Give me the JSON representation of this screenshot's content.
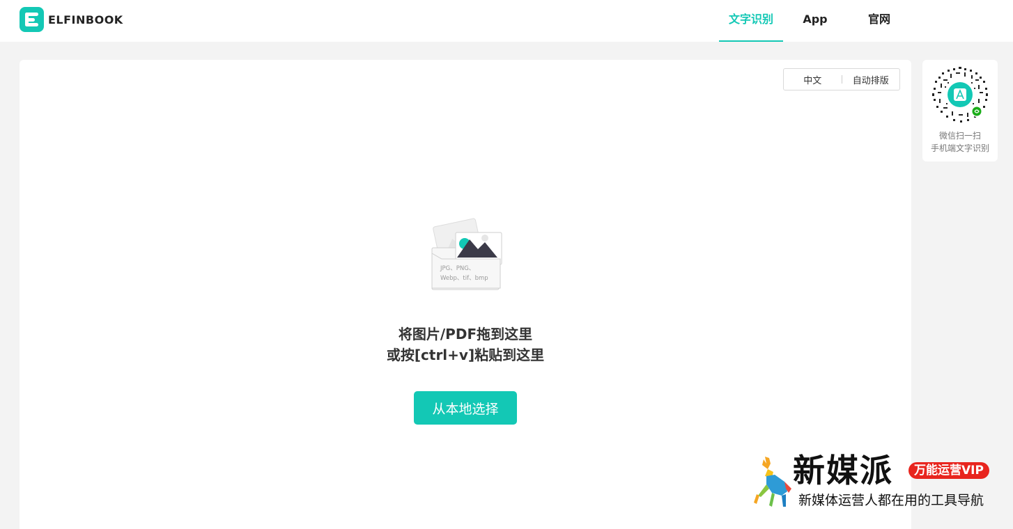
{
  "header": {
    "logo_text": "ELFINBOOK",
    "nav": [
      {
        "label": "文字识别",
        "active": true
      },
      {
        "label": "App",
        "active": false
      },
      {
        "label": "官网",
        "active": false
      }
    ]
  },
  "main": {
    "language_option": "中文",
    "layout_option": "自动排版",
    "illustration_formats_line1": "JPG、PNG、",
    "illustration_formats_line2": "Webp、tif、bmp",
    "drop_hint_line1": "将图片/PDF拖到这里",
    "drop_hint_line2": "或按[ctrl+v]粘贴到这里",
    "select_button": "从本地选择"
  },
  "qr_panel": {
    "line1": "微信扫一扫",
    "line2": "手机端文字识别"
  },
  "watermark": {
    "name": "新媒派",
    "badge": "万能运营VIP",
    "slogan": "新媒体运营人都在用的工具导航"
  },
  "colors": {
    "accent": "#13c8b5",
    "page_bg": "#f3f3f3",
    "badge_red": "#e8251e"
  }
}
